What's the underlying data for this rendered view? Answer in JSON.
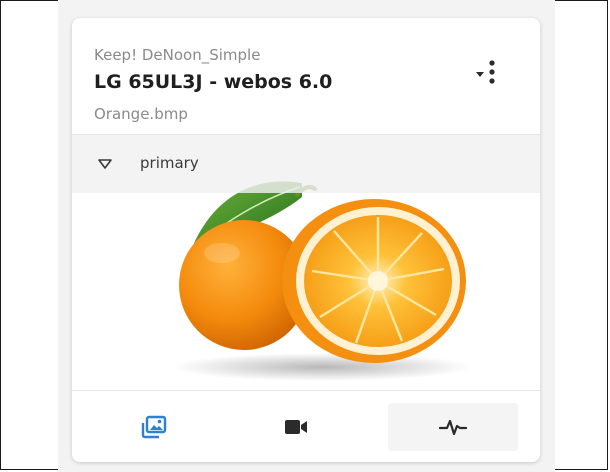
{
  "card": {
    "brand": "Keep! DeNoon_Simple",
    "title": "LG 65UL3J - webos 6.0",
    "filename": "Orange.bmp"
  },
  "image": {
    "section_label": "primary",
    "subject_icon": "orange-image"
  },
  "toolbar": {
    "icons": [
      "images-icon",
      "video-camera-icon",
      "waveform-icon"
    ],
    "active_color": "#2e7fd6",
    "inactive_color": "#2b2b2b"
  },
  "menu": {
    "icons": [
      "caret-down-icon",
      "more-vertical-icon"
    ]
  }
}
